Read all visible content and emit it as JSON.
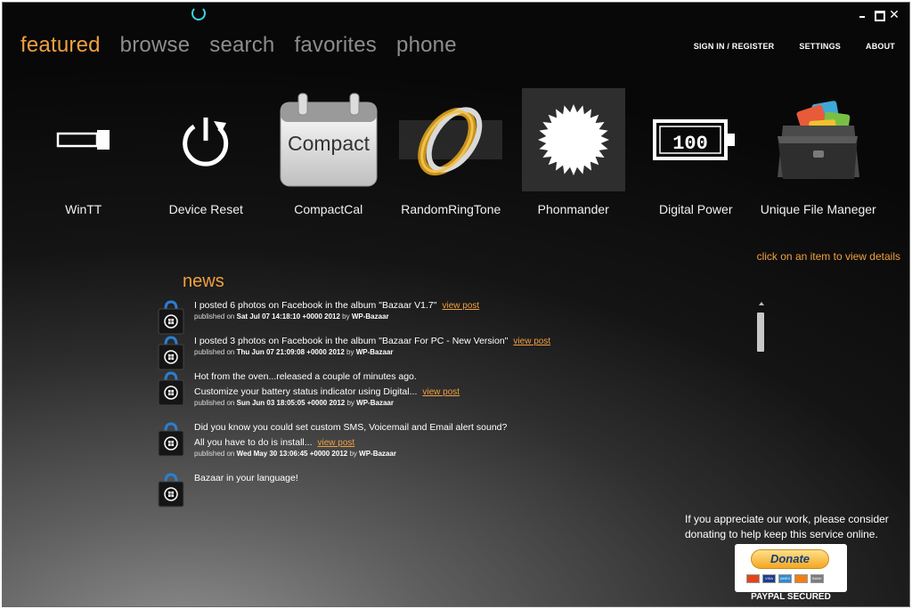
{
  "nav": {
    "items": [
      "featured",
      "browse",
      "search",
      "favorites",
      "phone"
    ],
    "active": "featured"
  },
  "top_links": {
    "signin": "SIGN IN / REGISTER",
    "settings": "SETTINGS",
    "about": "ABOUT"
  },
  "window": {
    "close_glyph": "✕"
  },
  "apps": [
    {
      "name": "WinTT",
      "icon": "usb-stick-icon"
    },
    {
      "name": "Device Reset",
      "icon": "power-reset-icon"
    },
    {
      "name": "CompactCal",
      "icon": "calendar-icon",
      "icon_text": "Compact"
    },
    {
      "name": "RandomRingTone",
      "icon": "rings-icon"
    },
    {
      "name": "Phonmander",
      "icon": "starburst-icon",
      "selected": true
    },
    {
      "name": "Digital Power",
      "icon": "battery-icon",
      "icon_text": "100"
    },
    {
      "name": "Unique File Maneger",
      "icon": "folder-icon"
    }
  ],
  "hint": "click on an item to view details",
  "news": {
    "title": "news",
    "view_label": "view post",
    "published_on": "published on",
    "by": "by",
    "items": [
      {
        "lines": [
          "I posted 6 photos on Facebook in the album \"Bazaar V1.7\""
        ],
        "date": "Sat Jul 07 14:18:10 +0000 2012",
        "author": "WP-Bazaar"
      },
      {
        "lines": [
          "I posted 3 photos on Facebook in the album \"Bazaar For PC - New Version\""
        ],
        "date": "Thu Jun 07 21:09:08 +0000 2012",
        "author": "WP-Bazaar"
      },
      {
        "lines": [
          "Hot from the oven...released a couple of minutes ago.",
          "Customize your battery status indicator using Digital..."
        ],
        "date": "Sun Jun 03 18:05:05 +0000 2012",
        "author": "WP-Bazaar"
      },
      {
        "lines": [
          "Did you know you could set custom SMS, Voicemail and Email alert sound?",
          "All you have to do is install..."
        ],
        "date": "Wed May 30 13:06:45 +0000 2012",
        "author": "WP-Bazaar"
      },
      {
        "lines": [
          "Bazaar in your language!"
        ],
        "date": "",
        "author": ""
      }
    ]
  },
  "donate": {
    "text": "If you appreciate our work, please consider donating to help keep this service online.",
    "button": "Donate",
    "cards": [
      "",
      "VISA",
      "AMEX",
      "",
      "BANK"
    ],
    "secured": "PAYPAL SECURED"
  },
  "colors": {
    "accent": "#f0a040",
    "nav_inactive": "#8d8d8d",
    "spinner": "#3bd3e8"
  }
}
